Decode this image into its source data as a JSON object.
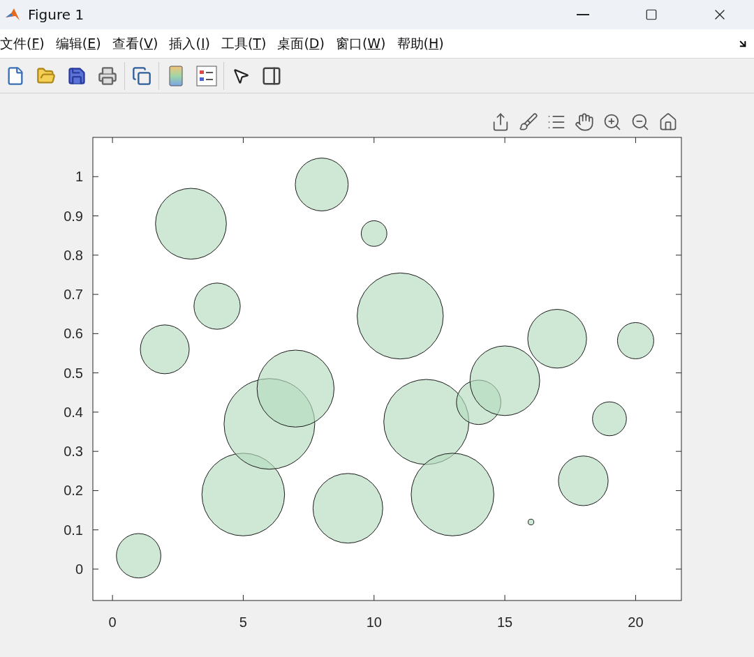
{
  "window": {
    "title": "Figure 1"
  },
  "menu": [
    {
      "label": "文件(",
      "key": "F",
      "rest": ")"
    },
    {
      "label": "编辑(",
      "key": "E",
      "rest": ")"
    },
    {
      "label": "查看(",
      "key": "V",
      "rest": ")"
    },
    {
      "label": "插入(",
      "key": "I",
      "rest": ")"
    },
    {
      "label": "工具(",
      "key": "T",
      "rest": ")"
    },
    {
      "label": "桌面(",
      "key": "D",
      "rest": ")"
    },
    {
      "label": "窗口(",
      "key": "W",
      "rest": ")"
    },
    {
      "label": "帮助(",
      "key": "H",
      "rest": ")"
    }
  ],
  "figure": {
    "chart_data": {
      "type": "scatter",
      "xlim": [
        -0.75,
        21.75
      ],
      "ylim": [
        -0.08,
        1.1
      ],
      "xticks": [
        0,
        5,
        10,
        15,
        20
      ],
      "yticks": [
        0,
        0.1,
        0.2,
        0.3,
        0.4,
        0.5,
        0.6,
        0.7,
        0.8,
        0.9,
        1
      ],
      "x": [
        1,
        2,
        3,
        4,
        5,
        6,
        7,
        8,
        9,
        10,
        11,
        12,
        13,
        14,
        15,
        16,
        17,
        18,
        19,
        20
      ],
      "series": [
        {
          "color": "#b3dcbf",
          "values": [
            0.034,
            0.56,
            0.88,
            0.67,
            0.19,
            0.37,
            0.46,
            0.98,
            0.155,
            0.855,
            0.645,
            0.375,
            0.19,
            0.425,
            0.48,
            0.12,
            0.587,
            0.225,
            0.383,
            0.582
          ],
          "sizes": [
            0.24,
            0.29,
            0.61,
            0.26,
            0.83,
            1,
            0.72,
            0.34,
            0.59,
            0.08,
            0.9,
            0.88,
            0.83,
            0.24,
            0.59,
            0.004,
            0.42,
            0.3,
            0.14,
            0.16
          ]
        }
      ]
    }
  }
}
